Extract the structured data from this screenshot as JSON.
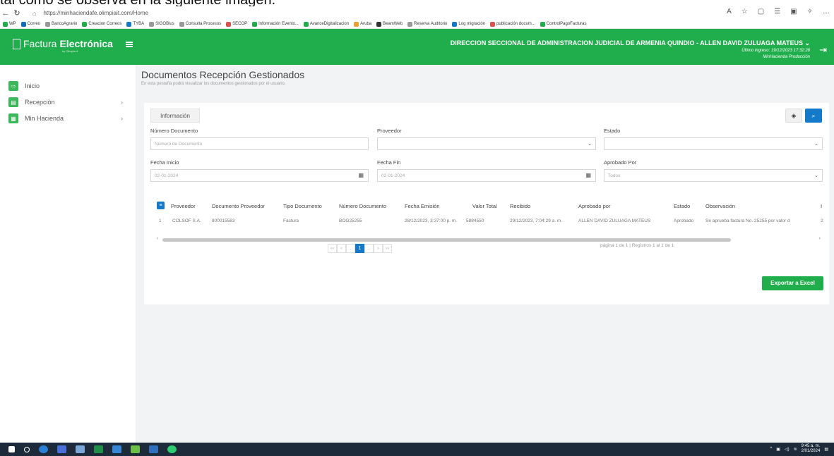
{
  "cut_caption": "tal como se observa en la siguiente imagen.",
  "browser": {
    "url": "https://minhaciendafe.olimpiait.com/Home"
  },
  "favorites": [
    {
      "label": "WP",
      "color": "#1fae4b"
    },
    {
      "label": "Correo",
      "color": "#0f6cbd"
    },
    {
      "label": "BancoAgrario",
      "color": "#999999"
    },
    {
      "label": "Creacion Correos",
      "color": "#1fae4b"
    },
    {
      "label": "TYBA",
      "color": "#1479c9"
    },
    {
      "label": "SIGOBius",
      "color": "#999999"
    },
    {
      "label": "Consulta Procesos",
      "color": "#999999"
    },
    {
      "label": "SECOP",
      "color": "#d9534f"
    },
    {
      "label": "Información Evento...",
      "color": "#1fae4b"
    },
    {
      "label": "AvanceDigitalizacion",
      "color": "#1fae4b"
    },
    {
      "label": "Aruba",
      "color": "#f0a030"
    },
    {
      "label": "BeamWeb",
      "color": "#333333"
    },
    {
      "label": "Reserva Auditorio",
      "color": "#999999"
    },
    {
      "label": "Log migración",
      "color": "#1479c9"
    },
    {
      "label": "publicación docum...",
      "color": "#d9534f"
    },
    {
      "label": "ControlPagoFacturas",
      "color": "#1fae4b"
    }
  ],
  "header": {
    "logo_light": "Factura",
    "logo_bold": "Electrónica",
    "logo_by": "by Olimpia it",
    "title": "DIRECCION SECCIONAL DE ADMINISTRACION JUDICIAL DE ARMENIA QUINDIO - ALLEN DAVID ZULUAGA MATEUS ⌄",
    "last_login": "Último ingreso: 19/12/2023 17:32:28",
    "environment": "MinHacienda Producción"
  },
  "sidebar": {
    "items": [
      {
        "label": "Inicio"
      },
      {
        "label": "Recepción"
      },
      {
        "label": "Min Hacienda"
      }
    ]
  },
  "page": {
    "title": "Documentos Recepción Gestionados",
    "subtitle": "En esta pestaña podrá visualizar los documentos gestionados por el usuario."
  },
  "filters": {
    "tab_label": "Información",
    "numero_label": "Número Documento",
    "numero_placeholder": "Número de Documento",
    "proveedor_label": "Proveedor",
    "estado_label": "Estado",
    "fecha_inicio_label": "Fecha Inicio",
    "fecha_inicio_value": "02-01-2024",
    "fecha_fin_label": "Fecha Fin",
    "fecha_fin_value": "02-01-2024",
    "aprobado_label": "Aprobado Por",
    "aprobado_value": "Todos"
  },
  "table": {
    "headers": [
      "Proveedor",
      "Documento Proveedor",
      "Tipo Documento",
      "Número Documento",
      "Fecha Emisión",
      "Valor Total",
      "Recibido",
      "Aprobado por",
      "Estado",
      "Observación",
      "I"
    ],
    "rows": [
      [
        "1",
        "COLSOF S.A.",
        "800015583",
        "Factura",
        "BOG25255",
        "28/12/2023, 3:37:00 p. m.",
        "5884550",
        "29/12/2023, 7:04:29 a. m.",
        "ALLEN DAVID ZULUAGA MATEUS",
        "Aprobado",
        "Se aprueba factura No. 25255 por valor d",
        "2"
      ]
    ]
  },
  "pagination": {
    "first": "<<",
    "prev": "<",
    "dots_left": "...",
    "current": "1",
    "dots_right": "...",
    "next": ">",
    "last": ">>",
    "info": "página 1 de 1 | Registros 1 al 1 de 1"
  },
  "actions": {
    "export_label": "Exportar a Excel"
  },
  "taskbar": {
    "time": "9:45 a. m.",
    "date": "2/01/2024"
  }
}
